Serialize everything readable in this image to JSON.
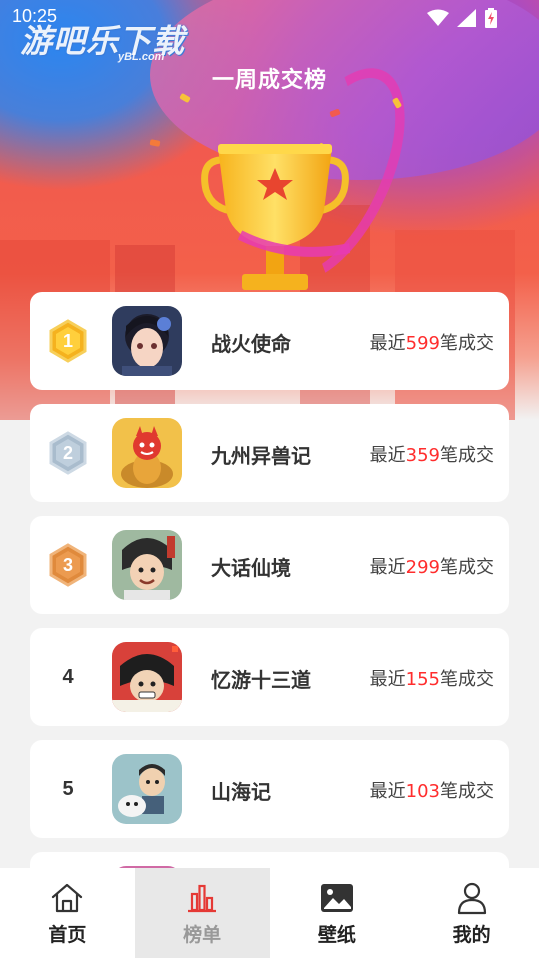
{
  "status": {
    "time": "10:25"
  },
  "logo": {
    "main": "游吧乐下载",
    "sub": "yBL.com"
  },
  "page": {
    "title": "一周成交榜"
  },
  "ranking": [
    {
      "rank": "1",
      "badge": "gold",
      "name": "战火使命",
      "prefix": "最近",
      "count": "599",
      "suffix": "笔成交"
    },
    {
      "rank": "2",
      "badge": "silver",
      "name": "九州异兽记",
      "prefix": "最近",
      "count": "359",
      "suffix": "笔成交"
    },
    {
      "rank": "3",
      "badge": "bronze",
      "name": "大话仙境",
      "prefix": "最近",
      "count": "299",
      "suffix": "笔成交"
    },
    {
      "rank": "4",
      "badge": "none",
      "name": "忆游十三道",
      "prefix": "最近",
      "count": "155",
      "suffix": "笔成交"
    },
    {
      "rank": "5",
      "badge": "none",
      "name": "山海记",
      "prefix": "最近",
      "count": "103",
      "suffix": "笔成交"
    }
  ],
  "nav": [
    {
      "label": "首页",
      "icon": "home-icon",
      "active": false
    },
    {
      "label": "榜单",
      "icon": "chart-icon",
      "active": true
    },
    {
      "label": "壁纸",
      "icon": "image-icon",
      "active": false
    },
    {
      "label": "我的",
      "icon": "user-icon",
      "active": false
    }
  ],
  "colors": {
    "accent": "#ff2d2d",
    "active_nav": "#e8e8e8",
    "gold": "#f5b21e",
    "silver": "#a9bccd",
    "bronze": "#e08a3c"
  }
}
